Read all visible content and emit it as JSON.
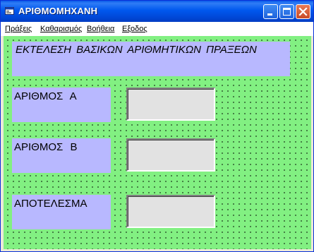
{
  "window": {
    "title": "ΑΡΙΘΜΟΜΗΧΑΝΗ",
    "app_icon": "vb-form-icon",
    "buttons": [
      "minimize-icon",
      "maximize-icon",
      "close-icon"
    ]
  },
  "menu": {
    "items": [
      {
        "label": "Πράξεις"
      },
      {
        "label": "Καθαρισμός"
      },
      {
        "label": "Βοήθεια"
      },
      {
        "label": "Εξοδος"
      }
    ]
  },
  "form": {
    "heading": "ΕΚΤΕΛΕΣΗ  ΒΑΣΙΚΩΝ  ΑΡΙΘΜΗΤΙΚΩΝ ΠΡΑΞΕΩΝ",
    "label_a": "ΑΡΙΘΜΟΣ  Α",
    "label_b": "ΑΡΙΘΜΟΣ  Β",
    "label_result": "ΑΠΟΤΕΛΕΣΜΑ",
    "value_a": "",
    "value_b": "",
    "value_result": ""
  },
  "colors": {
    "form_background": "#82f082",
    "label_background": "#b8b8ff",
    "textbox_background": "#e2e2e2",
    "titlebar": "#0058ee"
  }
}
